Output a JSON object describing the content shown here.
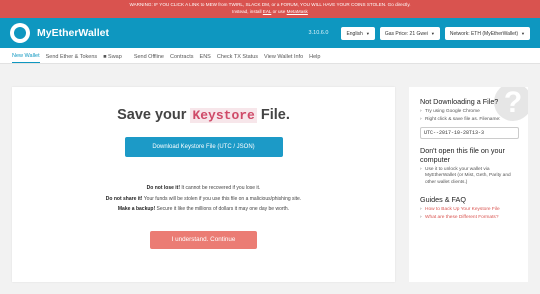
{
  "warning": {
    "line1": "WARNING: IF YOU CLICK A LINK to MEW from TWIRL, SLACK DM, or a FORUM, YOU WILL HAVE YOUR COINS STOLEN. Go directly.",
    "line2_pre": "Instead, install",
    "line2_link1": "EAL",
    "line2_mid": "or use",
    "line2_link2": "MetaMask"
  },
  "header": {
    "brand": "MyEtherWallet",
    "version": "3.10.6.0",
    "language": "English",
    "gas_price": "Gas Price: 21 Gwei",
    "network": "Network: ETH (MyEtherWallet)"
  },
  "nav": [
    "New Wallet",
    "Send Ether & Tokens",
    "Swap",
    "Send Offline",
    "Contracts",
    "ENS",
    "Check TX Status",
    "View Wallet Info",
    "Help"
  ],
  "main": {
    "title_pre": "Save your",
    "title_code": "Keystore",
    "title_post": "File.",
    "download_button": "Download Keystore File (UTC / JSON)",
    "note1_bold": "Do not lose it!",
    "note1_text": "It cannot be recovered if you lose it.",
    "note2_bold": "Do not share it!",
    "note2_text": "Your funds will be stolen if you use this file on a malicious/phishing site.",
    "note3_bold": "Make a backup!",
    "note3_text": "Secure it like the millions of dollars it may one day be worth.",
    "continue_button": "I understand. Continue"
  },
  "sidebar": {
    "section1_title": "Not Downloading a File?",
    "section1_items": [
      "Try using Google Chrome",
      "Right click & save file as. Filename:"
    ],
    "filename": "UTC--2017-10-28T13-3",
    "section2_title": "Don't open this file on your computer",
    "section2_items": [
      "Use it to unlock your wallet via MyEtherWallet (or Mist, Geth, Parity and other wallet clients.)"
    ],
    "section3_title": "Guides & FAQ",
    "section3_items": [
      "How to Back Up Your Keystore File",
      "What are these Different Formats?"
    ],
    "accent": "#d9534f"
  }
}
